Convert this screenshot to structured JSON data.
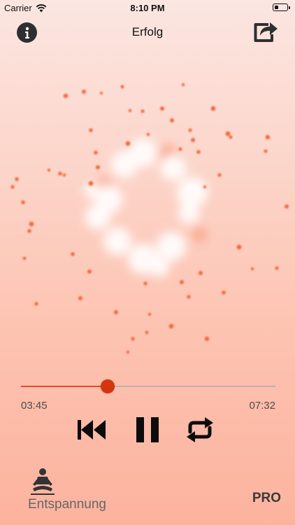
{
  "status_bar": {
    "carrier": "Carrier",
    "time": "8:10 PM",
    "battery_level": 0.2
  },
  "nav": {
    "title": "Erfolg",
    "info_icon": "info-icon",
    "share_icon": "share-icon"
  },
  "player": {
    "elapsed": "03:45",
    "total": "07:32",
    "progress": 0.34,
    "controls": [
      "skip-back-icon",
      "pause-icon",
      "repeat-icon"
    ]
  },
  "footer": {
    "mode_label": "Entspannung",
    "mode_icon": "meditation-icon",
    "pro_label": "PRO"
  },
  "colors": {
    "accent": "#d2350f",
    "track_fill": "#e04d2c",
    "particle": "#f26a3f",
    "ring": "#ffffff"
  }
}
